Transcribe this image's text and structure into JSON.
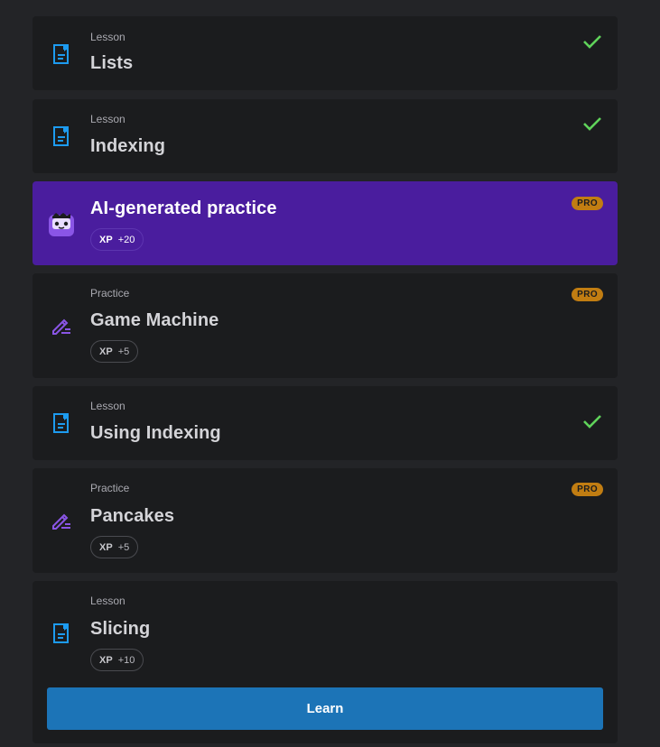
{
  "items": [
    {
      "kind": "Lesson",
      "title": "Lists",
      "icon": "lesson-doc-icon",
      "completed": true
    },
    {
      "kind": "Lesson",
      "title": "Indexing",
      "icon": "lesson-doc-icon",
      "completed": true
    },
    {
      "kind": "",
      "title": "AI-generated practice",
      "icon": "ai-mascot-icon",
      "badge": "PRO",
      "xp_label": "XP",
      "xp_value": "+20"
    },
    {
      "kind": "Practice",
      "title": "Game Machine",
      "icon": "practice-pencil-icon",
      "badge": "PRO",
      "xp_label": "XP",
      "xp_value": "+5"
    },
    {
      "kind": "Lesson",
      "title": "Using Indexing",
      "icon": "lesson-doc-icon",
      "completed": true
    },
    {
      "kind": "Practice",
      "title": "Pancakes",
      "icon": "practice-pencil-icon",
      "badge": "PRO",
      "xp_label": "XP",
      "xp_value": "+5"
    },
    {
      "kind": "Lesson",
      "title": "Slicing",
      "icon": "lesson-doc-icon",
      "xp_label": "XP",
      "xp_value": "+10"
    }
  ],
  "learn_button": "Learn",
  "colors": {
    "page_bg": "#232427",
    "card_bg": "#1b1c1e",
    "ai_card_bg": "#4a1d9e",
    "lesson_icon": "#1d9bf0",
    "practice_icon": "#8a55e6",
    "check": "#5fd35a",
    "pro_badge": "#c17d12",
    "learn_button": "#1c74b7"
  }
}
